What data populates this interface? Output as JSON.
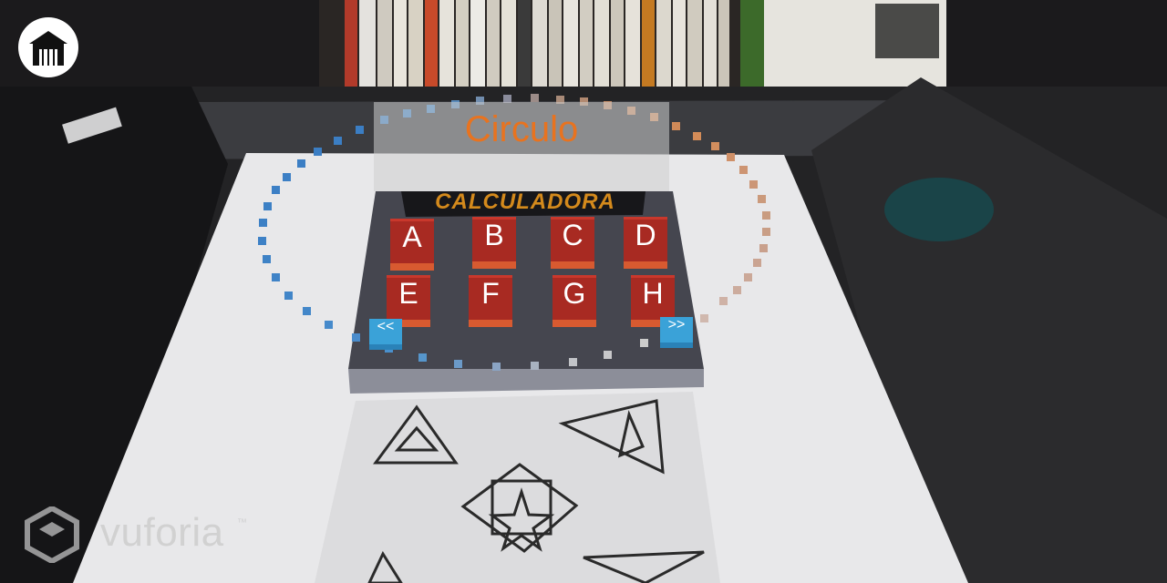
{
  "ar_scene": {
    "title": "Circulo",
    "banner_text": "CALCULADORA",
    "keys": [
      "A",
      "B",
      "C",
      "D",
      "E",
      "F",
      "G",
      "H"
    ],
    "prev_label": "<<",
    "next_label": ">>"
  },
  "toolbar": {
    "home_icon": "home-icon"
  },
  "watermark": {
    "brand": "vuforia",
    "trademark": "™"
  },
  "colors": {
    "title": "#e8731f",
    "key_face": "#a82a22",
    "key_side": "#d85a30",
    "nav_button": "#3aa2d8",
    "calculator_body": "#45464f"
  }
}
